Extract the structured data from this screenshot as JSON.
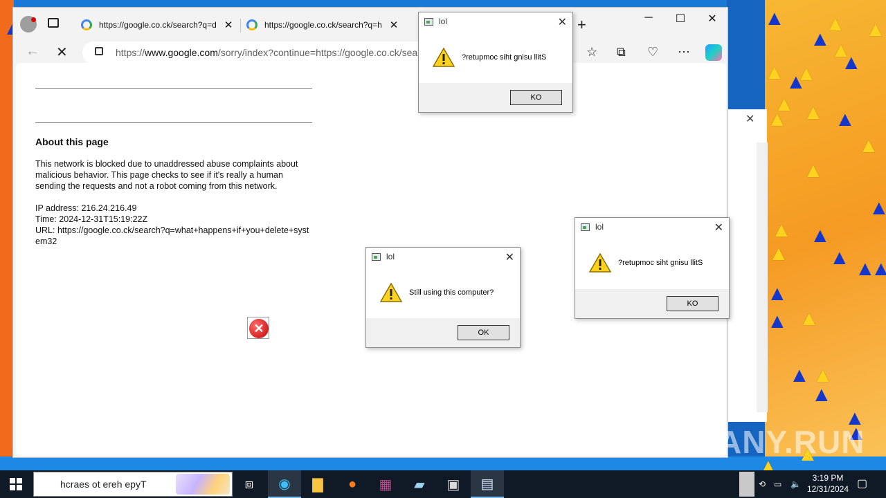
{
  "browser": {
    "tabs": [
      {
        "label": "https://google.co.ck/search?q=d"
      },
      {
        "label": "https://google.co.ck/search?q=h"
      }
    ],
    "address": {
      "scheme": "https://",
      "host": "www.google.com",
      "path": "/sorry/index?continue=https://google.co.ck/sear"
    }
  },
  "page": {
    "heading": "About this page",
    "paragraph": "This network is blocked due to unaddressed abuse complaints about malicious behavior. This page checks to see if it's really a human sending the requests and not a robot coming from this network.",
    "ip": "IP address: 216.24.216.49",
    "time": "Time: 2024-12-31T15:19:22Z",
    "url": "URL: https://google.co.ck/search?q=what+happens+if+you+delete+system32"
  },
  "dialogs": [
    {
      "title": "lol",
      "message": "?retupmoc siht gnisu llitS",
      "button": "KO"
    },
    {
      "title": "lol",
      "message": "Still using this computer?",
      "button": "OK"
    },
    {
      "title": "lol",
      "message": "?retupmoc siht gnisu llitS",
      "button": "KO"
    }
  ],
  "taskbar": {
    "search_text": "hcraes ot ereh epyT",
    "time": "3:19 PM",
    "date": "12/31/2024"
  },
  "watermark": "ANY.RUN",
  "colors": {
    "warning": "#ffd21f",
    "error": "#c40000",
    "taskbar": "#0f1a26"
  }
}
